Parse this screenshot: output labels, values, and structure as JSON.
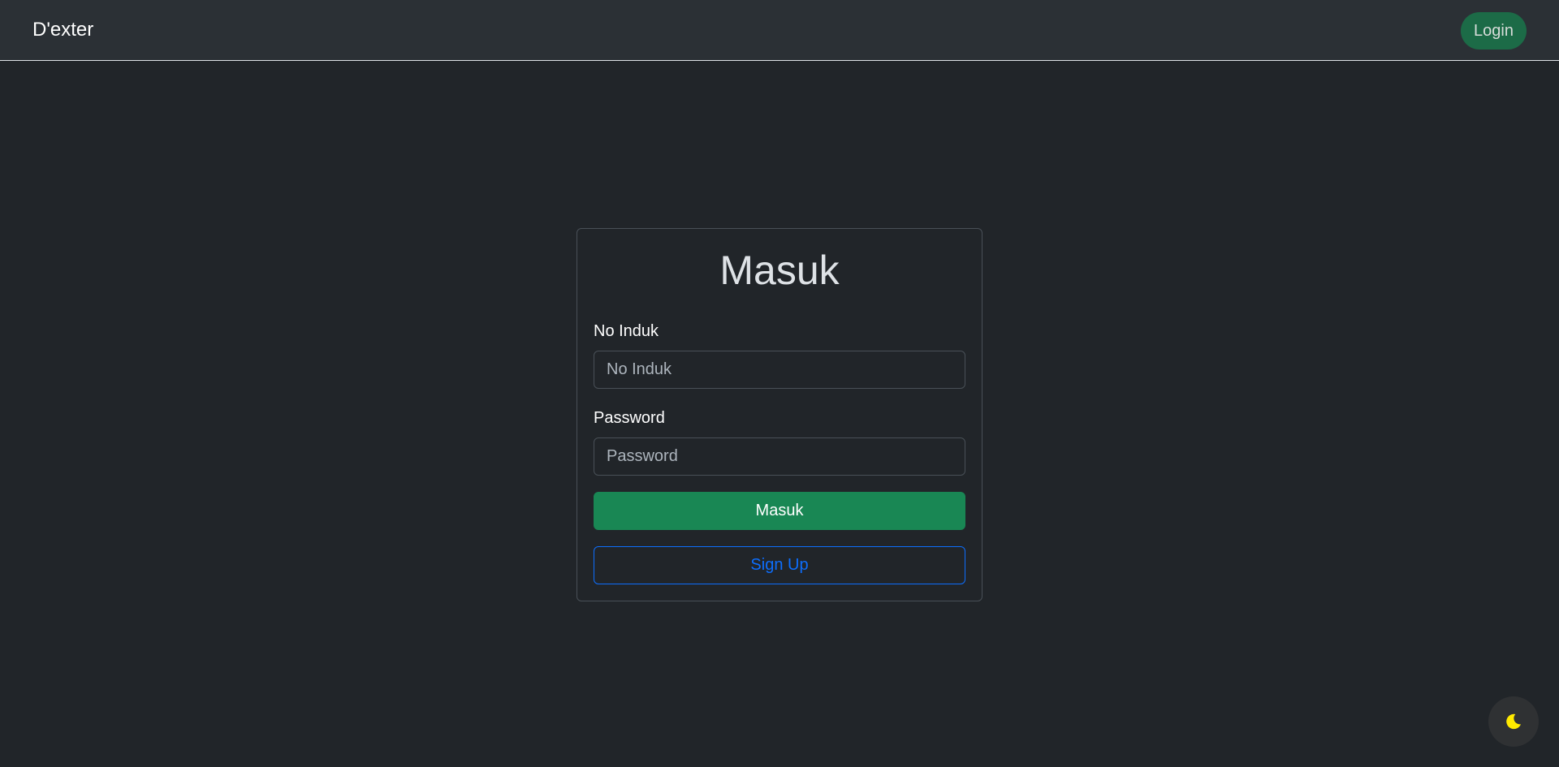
{
  "navbar": {
    "brand": "D'exter",
    "login_label": "Login"
  },
  "login_form": {
    "title": "Masuk",
    "no_induk": {
      "label": "No Induk",
      "placeholder": "No Induk",
      "value": ""
    },
    "password": {
      "label": "Password",
      "placeholder": "Password",
      "value": ""
    },
    "submit_label": "Masuk",
    "signup_label": "Sign Up"
  },
  "theme_toggle": {
    "icon": "moon-icon",
    "icon_color": "#ffea00"
  },
  "colors": {
    "background": "#212529",
    "navbar": "#2b3035",
    "success": "#198754",
    "primary": "#0d6efd"
  }
}
